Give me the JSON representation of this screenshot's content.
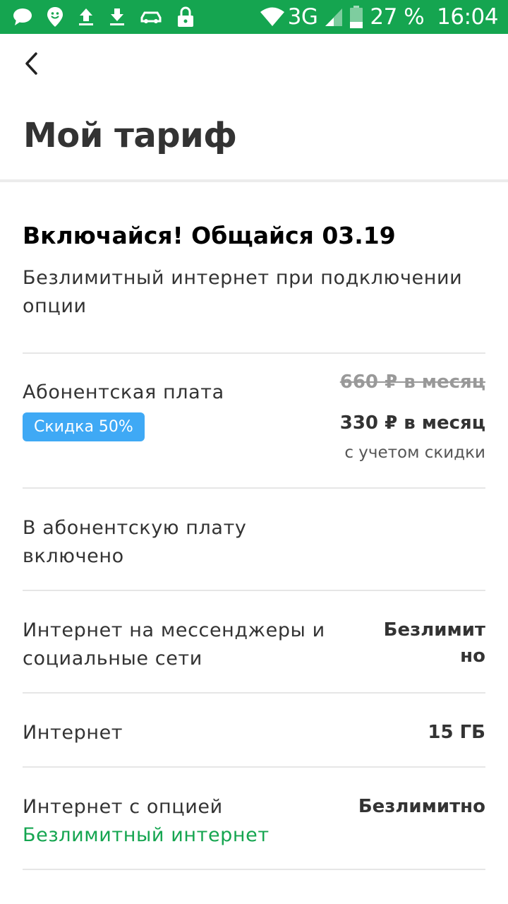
{
  "status_bar": {
    "icons_left": [
      "message-icon",
      "location-face-icon",
      "upload-icon",
      "download-icon",
      "car-icon",
      "lock-icon"
    ],
    "network": "3G",
    "battery": "27 %",
    "time": "16:04"
  },
  "header": {
    "title": "Мой тариф"
  },
  "tariff": {
    "name": "Включайся! Общайся 03.19",
    "description": "Безлимитный интернет при подключении опции"
  },
  "fee": {
    "label": "Абонентская плата",
    "discount": "Скидка 50%",
    "old_price": "660 ₽ в месяц",
    "new_price": "330 ₽ в месяц",
    "note": "с учетом скидки"
  },
  "included": {
    "label": "В абонентскую плату включено"
  },
  "rows": [
    {
      "label": "Интернет на мессенджеры и социальные сети",
      "value": "Безлимитно"
    },
    {
      "label": "Интернет",
      "value": "15 ГБ"
    },
    {
      "label": "Интернет с опцией",
      "link": "Безлимитный интернет",
      "value": "Безлимитно"
    }
  ],
  "colors": {
    "brand_green": "#15a550",
    "badge_blue": "#3fa9f5"
  }
}
